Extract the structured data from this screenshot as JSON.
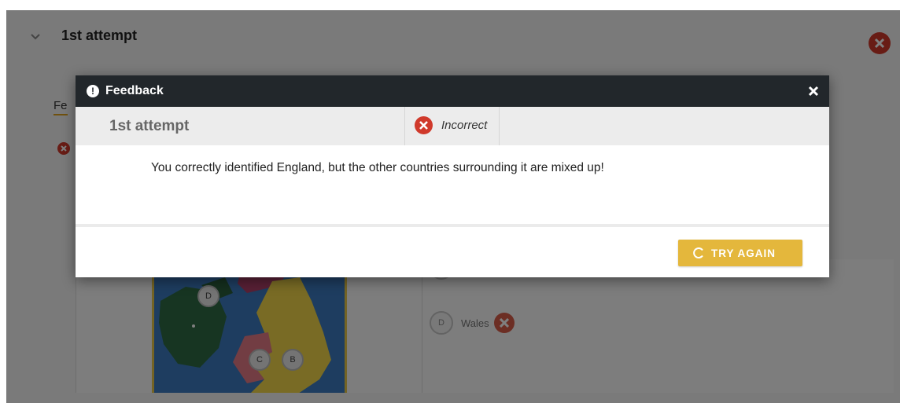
{
  "page": {
    "attempt_title": "1st attempt",
    "feedback_tab": "Fe",
    "map_markers": [
      "D",
      "C",
      "B"
    ],
    "answer_circle": "D",
    "answer_label": "Wales"
  },
  "modal": {
    "title": "Feedback",
    "attempt_label": "1st attempt",
    "status": "Incorrect",
    "message": "You correctly identified England, but the other countries surrounding it are mixed up!",
    "button_label": "TRY AGAIN"
  },
  "colors": {
    "titlebar": "#22272b",
    "incorrect": "#d0392b",
    "button": "#e4b73c",
    "map_sea": "#3c7ac0",
    "map_england": "#f2d64a",
    "map_ireland": "#2f6b45",
    "map_wales": "#e57b86"
  },
  "icons": [
    "chevron-down-icon",
    "close-circle-icon",
    "alert-icon",
    "close-icon",
    "incorrect-icon",
    "refresh-icon"
  ]
}
